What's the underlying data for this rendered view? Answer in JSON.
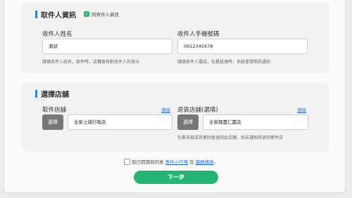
{
  "recipient": {
    "title": "取件人資訊",
    "same_as_sender_label": "同寄件人資訊",
    "name_label": "收件人姓名",
    "name_value": "測試",
    "name_hint": "請填收件人姓名，取件時，店舖會核對收件人的身分",
    "phone_label": "收件人手機號碼",
    "phone_value": "0912345678",
    "phone_hint": "請填收件人電話，包裹抵達時，系統會發簡訊通知"
  },
  "store": {
    "title": "選擇店舖",
    "pickup_label": "取件店舖",
    "pickup_clear": "清除",
    "pickup_select": "選擇",
    "pickup_value": "全家士城行政店",
    "return_label": "退貨店舖(選填)",
    "return_clear": "清除",
    "return_select": "選擇",
    "return_value": "全家興農仁農店",
    "return_hint": "包裹未取或貨寄回會退回此店舖，如未選取將退回寄件店"
  },
  "agreement": {
    "prefix": "我已閱讀與同意",
    "link1": "寄件小叮嚀",
    "middle": "及",
    "link2": "服務條款",
    "suffix": "。"
  },
  "next_label": "下一步"
}
